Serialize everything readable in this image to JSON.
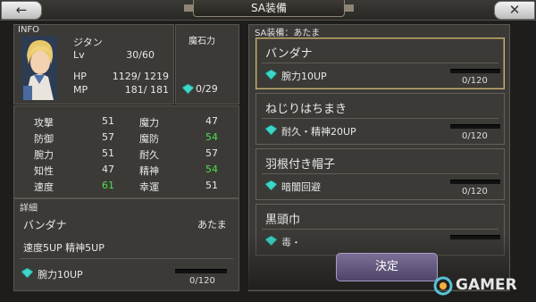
{
  "header": {
    "title": "SA装備",
    "back_icon": "arrow-left",
    "close_icon": "x"
  },
  "info": {
    "label": "INFO",
    "name": "ジタン",
    "lv_label": "Lv",
    "lv_value": "30/60",
    "hp_label": "HP",
    "hp_value": "1129/ 1219",
    "mp_label": "MP",
    "mp_value": "181/  181"
  },
  "magicite": {
    "label": "魔石力",
    "value": "0/29"
  },
  "stats": [
    {
      "label": "攻撃",
      "value": "51",
      "green": false
    },
    {
      "label": "魔力",
      "value": "47",
      "green": false
    },
    {
      "label": "防御",
      "value": "57",
      "green": false
    },
    {
      "label": "魔防",
      "value": "54",
      "green": true
    },
    {
      "label": "腕力",
      "value": "51",
      "green": false
    },
    {
      "label": "耐久",
      "value": "57",
      "green": false
    },
    {
      "label": "知性",
      "value": "47",
      "green": false
    },
    {
      "label": "精神",
      "value": "54",
      "green": true
    },
    {
      "label": "速度",
      "value": "61",
      "green": true
    },
    {
      "label": "幸運",
      "value": "51",
      "green": false
    }
  ],
  "detail": {
    "label": "詳細",
    "name": "バンダナ",
    "slot": "あたま",
    "bonus": "速度5UP  精神5UP",
    "effect": "腕力10UP",
    "progress": 0,
    "count": "0/120"
  },
  "sa_panel": {
    "label": "SA装備：あたま",
    "items": [
      {
        "name": "バンダナ",
        "effect": "腕力10UP",
        "count": "0/120",
        "progress": 0,
        "selected": true
      },
      {
        "name": "ねじりはちまき",
        "effect": "耐久・精神20UP",
        "count": "0/120",
        "progress": 0,
        "selected": false
      },
      {
        "name": "羽根付き帽子",
        "effect": "暗闇回避",
        "count": "0/120",
        "progress": 0,
        "selected": false
      },
      {
        "name": "黒頭巾",
        "effect": "毒・ ",
        "count": "",
        "progress": 0,
        "selected": false
      }
    ]
  },
  "decide_label": "決定",
  "watermark": "GAMER",
  "colors": {
    "gem": "#3fd6c8",
    "green_stat": "#4be04b",
    "selected_border": "#c9b27a"
  }
}
